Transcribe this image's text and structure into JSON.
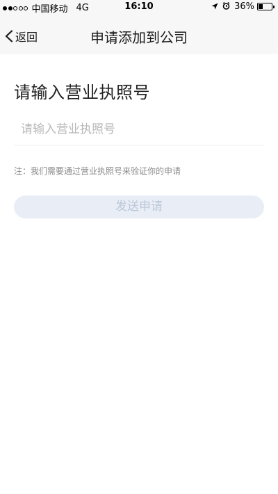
{
  "status_bar": {
    "signal_dots": [
      true,
      true,
      false,
      false,
      false
    ],
    "carrier": "中国移动",
    "network": "4G",
    "time": "16:10",
    "battery_percent": "36%",
    "battery_level": 0.36
  },
  "nav": {
    "back_label": "返回",
    "title": "申请添加到公司"
  },
  "form": {
    "heading": "请输入营业执照号",
    "license_placeholder": "请输入营业执照号",
    "license_value": "",
    "note": "注：我们需要通过营业执照号来验证你的申请",
    "send_label": "发送申请"
  },
  "colors": {
    "nav_background": "#f7f7f7",
    "button_disabled_bg": "#e9eef6",
    "button_disabled_text": "#bcc7da",
    "placeholder": "#b8b8b8",
    "note_text": "#8a8a8a"
  }
}
